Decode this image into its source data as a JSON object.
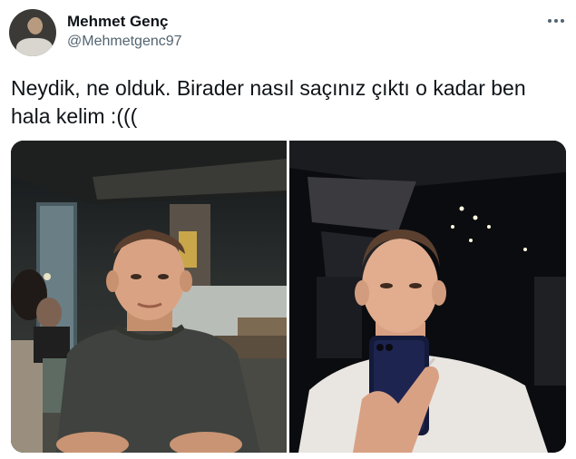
{
  "author": {
    "display_name": "Mehmet Genç",
    "handle": "@Mehmetgenc97",
    "avatar_icon": "profile-avatar"
  },
  "tweet": {
    "text_line_1": "Neydik, ne olduk. Birader nasıl saçınız çıktı o kadar ben",
    "text_line_2": "hala kelim :((("
  },
  "menu": {
    "icon": "more-horizontal-icon"
  },
  "media": {
    "count": 2,
    "photos": [
      {
        "position": "left",
        "scene": "outdoor-terrace-night"
      },
      {
        "position": "right",
        "scene": "mirror-selfie-elevator"
      }
    ]
  },
  "colors": {
    "text_primary": "#0f1419",
    "text_secondary": "#536471",
    "background": "#ffffff"
  }
}
